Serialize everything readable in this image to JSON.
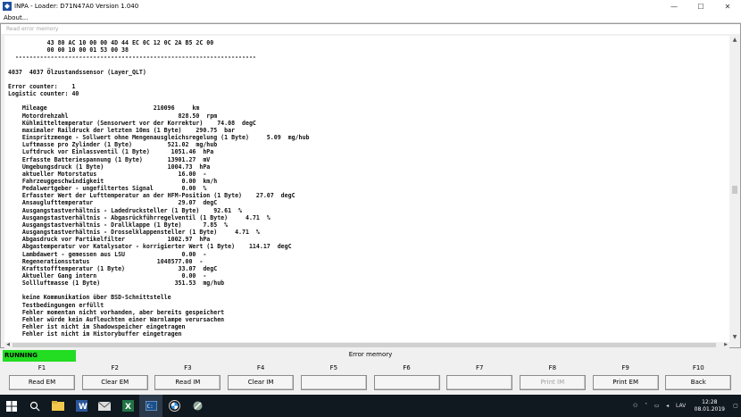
{
  "window": {
    "title": "INPA - Loader:  D71N47A0 Version 1.040"
  },
  "menu": {
    "items": [
      "About..."
    ]
  },
  "inner_window": {
    "title": "Read error memory"
  },
  "content": {
    "lines": [
      "           43 80 AC 10 00 00 4D 44 EC 0C 12 0C 2A B5 2C 00",
      "           00 00 10 00 01 53 00 38",
      "  --------------------------------------------------------------------",
      "",
      "4037  4037 Ölzustandssensor (Layer_QLT)",
      "",
      "Error counter:    1",
      "Logistic counter: 40",
      "",
      "    Mileage                              210096     km",
      "    Motordrehzahl                               828.50  rpm",
      "    Kühlmitteltemperatur (Sensorwert vor der Korrektur)    74.08  degC",
      "    maximaler Raildruck der letzten 10ms (1 Byte)    290.75  bar",
      "    Einspritzmenge - Sollwert ohne Mengenausgleichsregelung (1 Byte)     5.09  mg/hub",
      "    Luftmasse pro Zylinder (1 Byte)          521.02  mg/hub",
      "    Luftdruck vor Einlassventil (1 Byte)      1051.46  hPa",
      "    Erfasste Batteriespannung (1 Byte)       13901.27  mV",
      "    Umgebungsdruck (1 Byte)                  1004.73  hPa",
      "    aktueller Motorstatus                       16.00  -",
      "    Fahrzeuggeschwindigkeit                      0.00  km/h",
      "    Pedalwertgeber - ungefiltertes Signal        0.00  %",
      "    Erfasster Wert der Lufttemperatur an der HFM-Position (1 Byte)    27.07  degC",
      "    Ansauglufttemperatur                        29.07  degC",
      "    Ausgangstastverhältnis - Ladedrucksteller (1 Byte)    92.61  %",
      "    Ausgangstastverhältnis - Abgasrückführregelventil (1 Byte)     4.71  %",
      "    Ausgangstastverhältnis - Drallklappe (1 Byte)      7.85  %",
      "    Ausgangstastverhältnis - Drosselklappensteller (1 Byte)     4.71  %",
      "    Abgasdruck vor Partikelfilter            1002.97  hPa",
      "    Abgastemperatur vor Katalysator - korrigierter Wert (1 Byte)    114.17  degC",
      "    Lambdawert - gemessen aus LSU                0.00  -",
      "    Regenerationsstatus                   1048577.00  -",
      "    Kraftstofftemperatur (1 Byte)               33.07  degC",
      "    Aktueller Gang intern                        0.00  -",
      "    Sollluftmasse (1 Byte)                     351.53  mg/hub",
      "",
      "    keine Kommunikation über BSD-Schnittstelle",
      "    Testbedingungen erfüllt",
      "    Fehler momentan nicht vorhanden, aber bereits gespeichert",
      "    Fehler würde kein Aufleuchten einer Warnlampe verursachen",
      "    Fehler ist nicht im Shadowspeicher eingetragen",
      "    Fehler ist nicht im Historybuffer eingetragen"
    ]
  },
  "status": {
    "state": "RUNNING",
    "title": "Error memory",
    "running_color": "#22dd22"
  },
  "fkeys": [
    {
      "key": "F1",
      "label": "Read EM",
      "enabled": true
    },
    {
      "key": "F2",
      "label": "Clear EM",
      "enabled": true
    },
    {
      "key": "F3",
      "label": "Read IM",
      "enabled": true
    },
    {
      "key": "F4",
      "label": "Clear IM",
      "enabled": true
    },
    {
      "key": "F5",
      "label": "",
      "enabled": true
    },
    {
      "key": "F6",
      "label": "",
      "enabled": true
    },
    {
      "key": "F7",
      "label": "",
      "enabled": true
    },
    {
      "key": "F8",
      "label": "Print IM",
      "enabled": false
    },
    {
      "key": "F9",
      "label": "Print EM",
      "enabled": true
    },
    {
      "key": "F10",
      "label": "Back",
      "enabled": true
    }
  ],
  "taskbar": {
    "icons": [
      "windows-start-icon",
      "search-icon",
      "file-explorer-icon",
      "word-icon",
      "mail-icon",
      "excel-icon",
      "cmd-icon",
      "bmw-icon",
      "tool-icon"
    ],
    "tray_language": "LAV",
    "time": "12:28",
    "date": "08.01.2019"
  }
}
